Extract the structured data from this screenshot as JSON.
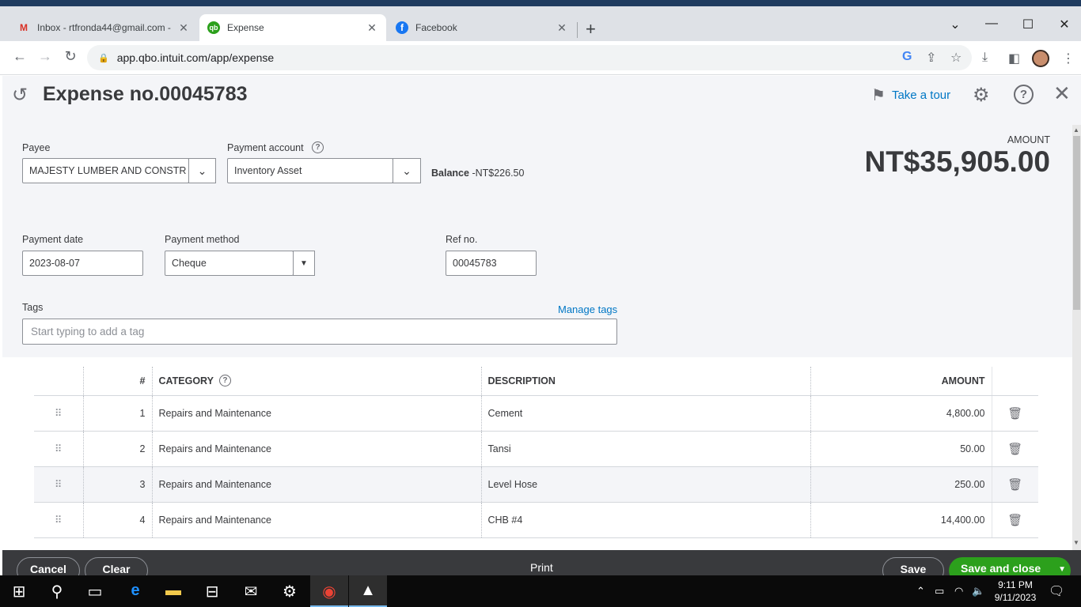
{
  "browser": {
    "tabs": [
      {
        "title": "Inbox - rtfronda44@gmail.com -",
        "icon": "gmail-icon"
      },
      {
        "title": "Expense",
        "icon": "quickbooks-icon"
      },
      {
        "title": "Facebook",
        "icon": "facebook-icon"
      }
    ],
    "url": "app.qbo.intuit.com/app/expense"
  },
  "header": {
    "title": "Expense no.00045783",
    "take_tour": "Take a tour"
  },
  "form": {
    "payee_label": "Payee",
    "payee_value": "MAJESTY LUMBER AND CONSTR",
    "payment_account_label": "Payment account",
    "payment_account_value": "Inventory Asset",
    "balance_label": "Balance",
    "balance_value": "-NT$226.50",
    "amount_label": "AMOUNT",
    "amount_value": "NT$35,905.00",
    "payment_date_label": "Payment date",
    "payment_date_value": "2023-08-07",
    "payment_method_label": "Payment method",
    "payment_method_value": "Cheque",
    "ref_label": "Ref no.",
    "ref_value": "00045783",
    "tags_label": "Tags",
    "manage_tags": "Manage tags",
    "tags_placeholder": "Start typing to add a tag"
  },
  "table": {
    "headers": {
      "num": "#",
      "category": "CATEGORY",
      "description": "DESCRIPTION",
      "amount": "AMOUNT"
    },
    "rows": [
      {
        "num": "1",
        "category": "Repairs and Maintenance",
        "description": "Cement",
        "amount": "4,800.00"
      },
      {
        "num": "2",
        "category": "Repairs and Maintenance",
        "description": "Tansi",
        "amount": "50.00"
      },
      {
        "num": "3",
        "category": "Repairs and Maintenance",
        "description": "Level Hose",
        "amount": "250.00"
      },
      {
        "num": "4",
        "category": "Repairs and Maintenance",
        "description": "CHB #4",
        "amount": "14,400.00"
      }
    ]
  },
  "footer": {
    "cancel": "Cancel",
    "clear": "Clear",
    "print": "Print",
    "save": "Save",
    "save_close": "Save and close"
  },
  "taskbar": {
    "time": "9:11 PM",
    "date": "9/11/2023"
  },
  "colors": {
    "link": "#0077c5",
    "primary_green": "#2ca01c",
    "footer_bg": "#393a3d",
    "page_bg": "#f4f5f8"
  }
}
